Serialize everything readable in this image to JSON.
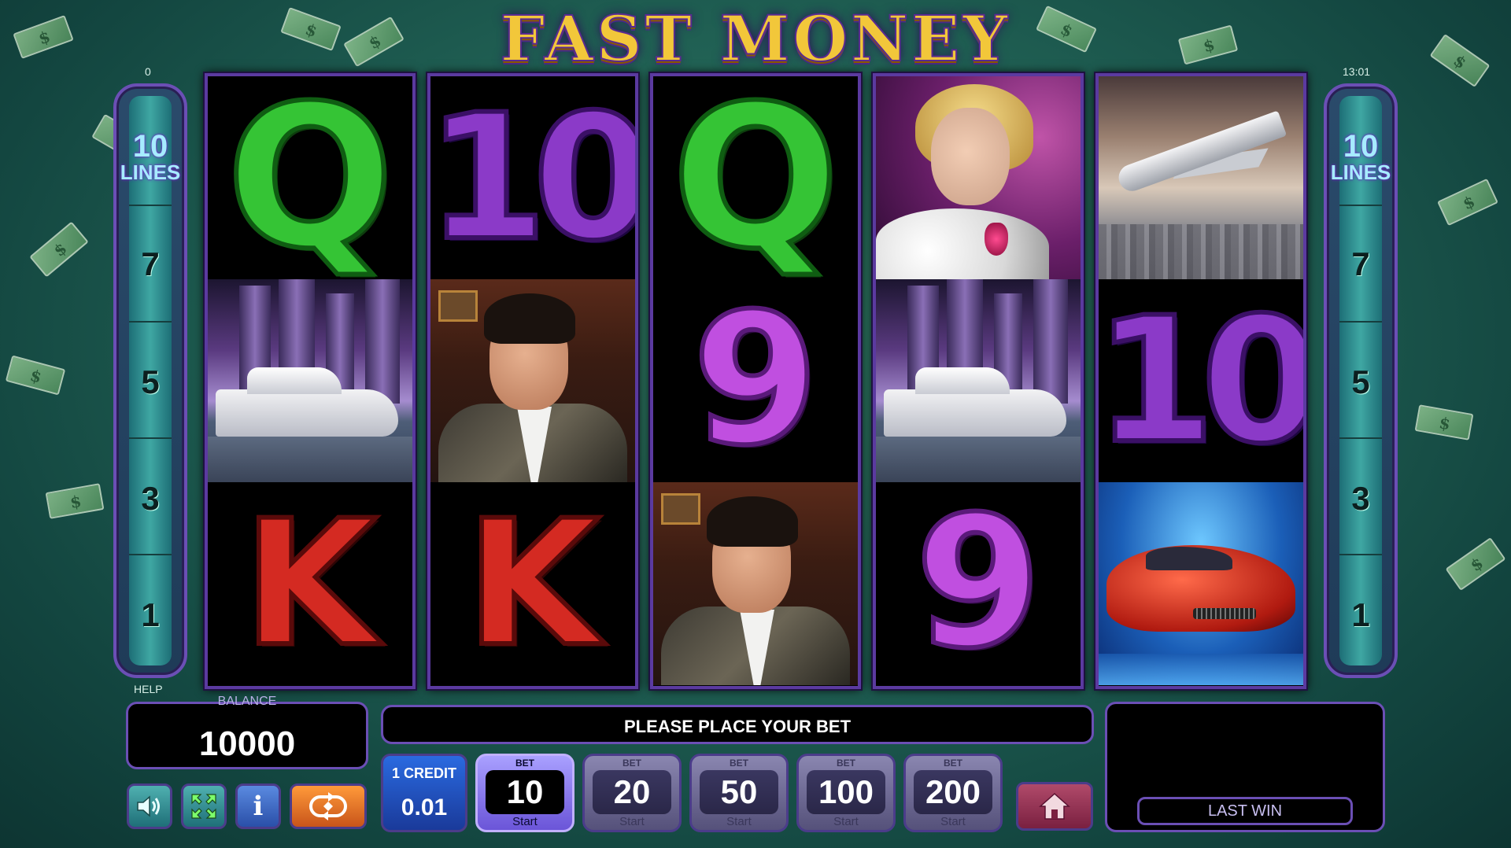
{
  "game": {
    "title": "FAST MONEY"
  },
  "top": {
    "left_value": "0",
    "clock": "13:01"
  },
  "lines_panel": {
    "count": "10",
    "label": "LINES",
    "numbers": [
      "7",
      "5",
      "3",
      "1"
    ]
  },
  "reels": [
    [
      "Q",
      "yacht",
      "K"
    ],
    [
      "10",
      "man",
      "K"
    ],
    [
      "Q",
      "9",
      "man"
    ],
    [
      "woman",
      "yacht",
      "9"
    ],
    [
      "jet",
      "10",
      "car"
    ]
  ],
  "help_label": "HELP",
  "balance": {
    "label": "BALANCE",
    "value": "10000"
  },
  "message": "PLEASE PLACE YOUR BET",
  "last_win": {
    "label": "LAST WIN",
    "value": ""
  },
  "credit": {
    "label": "1 CREDIT",
    "value": "0.01"
  },
  "bets": [
    {
      "label": "BET",
      "value": "10",
      "sub": "Start",
      "active": true
    },
    {
      "label": "BET",
      "value": "20",
      "sub": "Start",
      "active": false
    },
    {
      "label": "BET",
      "value": "50",
      "sub": "Start",
      "active": false
    },
    {
      "label": "BET",
      "value": "100",
      "sub": "Start",
      "active": false
    },
    {
      "label": "BET",
      "value": "200",
      "sub": "Start",
      "active": false
    }
  ],
  "buttons": {
    "sound": "sound-icon",
    "fullscreen": "fullscreen-icon",
    "info": "i",
    "autoplay": "autoplay-icon",
    "home": "home-icon"
  },
  "colors": {
    "frame": "#6b4fb5",
    "background": "#1f5e52",
    "active_bet": "#6b55d8",
    "title": "#f2c73a"
  }
}
